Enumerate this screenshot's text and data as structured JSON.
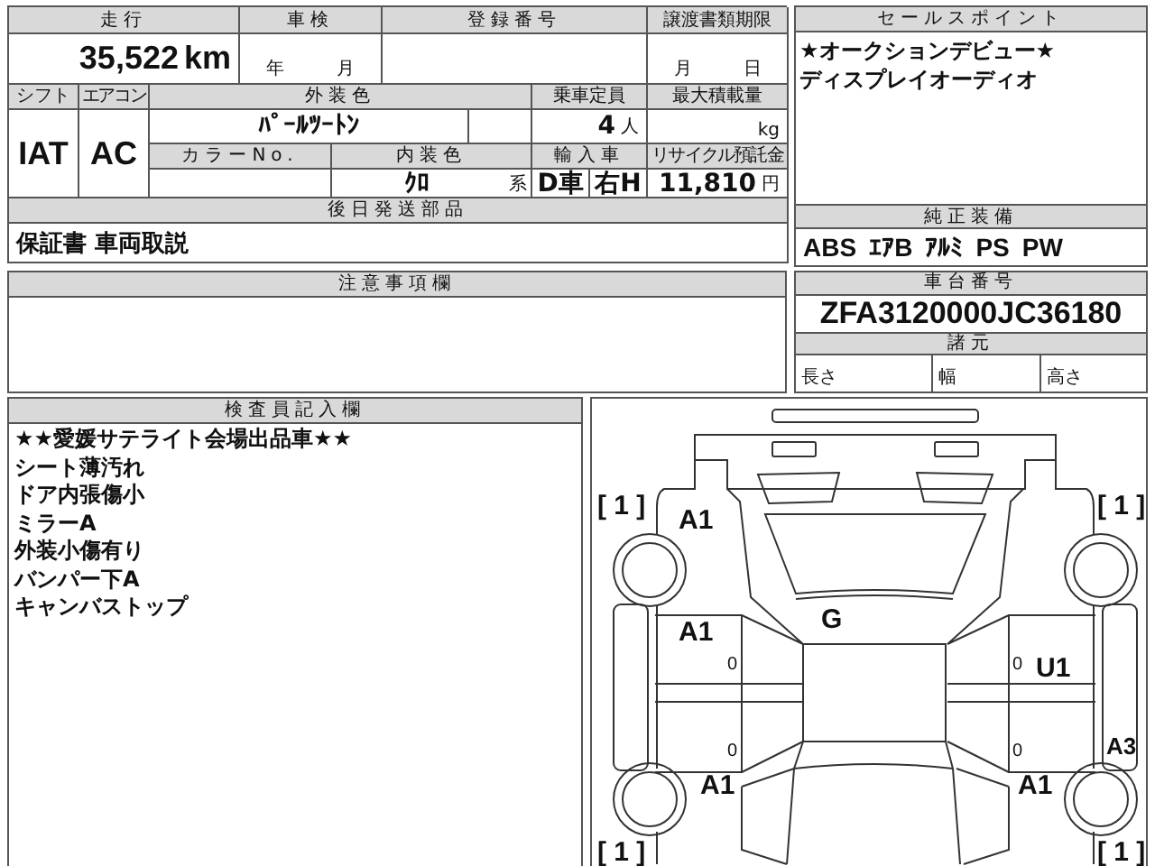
{
  "summary": {
    "mileage_label": "走行",
    "mileage": "35,522",
    "mileage_unit": "km",
    "inspection_label": "車検",
    "inspection_year_unit": "年",
    "inspection_month_unit": "月",
    "registration_label": "登録番号",
    "transfer_deadline_label": "譲渡書類期限",
    "transfer_month_unit": "月",
    "transfer_day_unit": "日",
    "shift_label": "シフト",
    "ac_label": "エアコン",
    "exterior_color_label": "外装色",
    "capacity_label": "乗車定員",
    "max_load_label": "最大積載量",
    "shift": "IAT",
    "ac": "AC",
    "exterior_color": "ﾊﾟｰﾙﾂｰﾄﾝ",
    "capacity": "4",
    "capacity_unit": "人",
    "max_load_unit": "kg",
    "color_no_label": "カラーNo.",
    "interior_color_label": "内装色",
    "import_label": "輸入車",
    "recycle_label": "リサイクル預託金",
    "interior_color": "ｸﾛ",
    "interior_suffix": "系",
    "import_type": "D車",
    "steering": "右H",
    "recycle_fee": "11,810",
    "recycle_unit": "円",
    "later_parts_label": "後日発送部品",
    "later_parts": "保証書 車両取説"
  },
  "sales_points": {
    "title": "セールスポイント",
    "lines": [
      "★オークションデビュー★",
      "ディスプレイオーディオ"
    ]
  },
  "equipment": {
    "title": "純正装備",
    "items": [
      "ABS",
      "ｴｱB",
      "ｱﾙﾐ",
      "PS",
      "PW"
    ]
  },
  "notes": {
    "title": "注意事項欄"
  },
  "chassis": {
    "title": "車台番号",
    "number": "ZFA3120000JC36180",
    "specs_title": "諸元",
    "specs": [
      "長さ",
      "幅",
      "高さ"
    ]
  },
  "inspector": {
    "title": "検査員記入欄",
    "lines": [
      "★★愛媛サテライト会場出品車★★",
      "シート薄汚れ",
      "ドア内張傷小",
      "ミラーA",
      "外装小傷有り",
      "バンパー下A",
      "キャンバストップ"
    ]
  },
  "diagram": {
    "marks": [
      {
        "kind": "tire",
        "text": "[ 1 ]"
      },
      {
        "kind": "tire",
        "text": "[ 1 ]"
      },
      {
        "kind": "damage",
        "text": "A1"
      },
      {
        "kind": "damage",
        "text": "A1"
      },
      {
        "kind": "damage",
        "text": "G"
      },
      {
        "kind": "door",
        "text": "0"
      },
      {
        "kind": "door",
        "text": "0"
      },
      {
        "kind": "damage",
        "text": "U1"
      },
      {
        "kind": "door",
        "text": "0"
      },
      {
        "kind": "door",
        "text": "0"
      },
      {
        "kind": "damage",
        "text": "A3"
      },
      {
        "kind": "damage",
        "text": "A1"
      },
      {
        "kind": "damage",
        "text": "A1"
      },
      {
        "kind": "tire",
        "text": "[ 1 ]"
      },
      {
        "kind": "tire",
        "text": "[ 1 ]"
      }
    ]
  }
}
